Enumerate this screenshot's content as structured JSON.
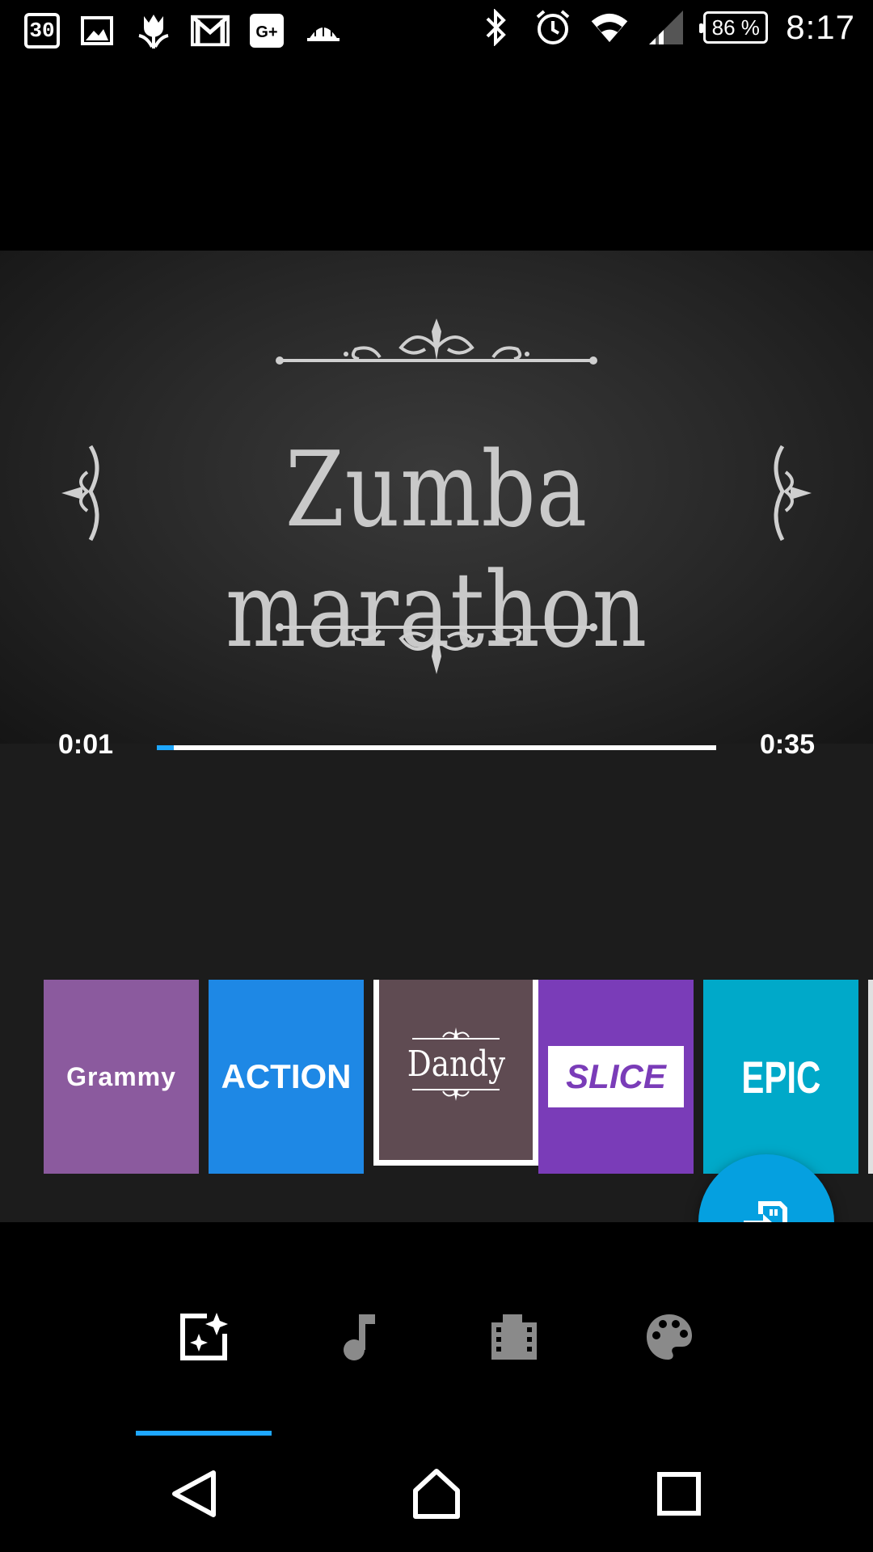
{
  "status_bar": {
    "calendar_day": "30",
    "notification_icons": [
      "calendar-icon",
      "image-icon",
      "tulip-icon",
      "gmail-icon",
      "google-plus-icon",
      "dome-icon"
    ],
    "google_plus_label": "G+",
    "system_icons": [
      "bluetooth-icon",
      "alarm-icon",
      "wifi-icon",
      "signal-icon"
    ],
    "battery": "86 %",
    "time": "8:17"
  },
  "preview": {
    "title": "Zumba marathon",
    "current_time": "0:01",
    "total_time": "0:35",
    "progress": 0.03
  },
  "themes": {
    "selected": "Dandy",
    "items": [
      {
        "label": "Grammy",
        "color": "#8b5a9e"
      },
      {
        "label": "ACTION",
        "color": "#1e88e5"
      },
      {
        "label": "Dandy",
        "color": "#5f4b52"
      },
      {
        "label": "SLICE",
        "color": "#7a3cb8"
      },
      {
        "label": "EPIC",
        "color": "#00a9c9"
      }
    ]
  },
  "fab": {
    "icon": "export-icon",
    "color": "#05a0e0"
  },
  "bottom_tabs": {
    "selected_index": 0,
    "items": [
      {
        "icon": "theme-sparkle-icon"
      },
      {
        "icon": "music-note-icon"
      },
      {
        "icon": "film-icon"
      },
      {
        "icon": "palette-icon"
      }
    ]
  },
  "navigation": [
    "back-icon",
    "home-icon",
    "recents-icon"
  ],
  "accent_color": "#1ea7ff"
}
